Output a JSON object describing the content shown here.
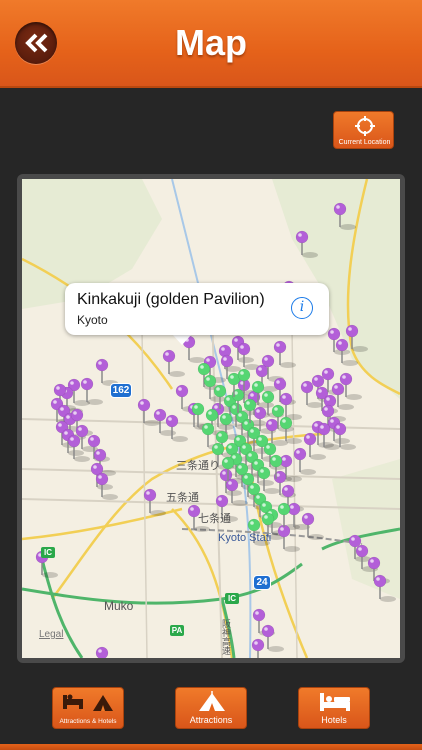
{
  "header": {
    "title": "Map",
    "back_icon": "back-chevrons-icon"
  },
  "current_location": {
    "label": "Current Location",
    "icon": "crosshair-icon"
  },
  "map": {
    "callout": {
      "title": "Kinkakuji (golden Pavilion)",
      "subtitle": "Kyoto",
      "info_icon": "info-icon"
    },
    "labels": {
      "sanjo": "三条通り",
      "gojo": "五条通",
      "shichijo": "七条通",
      "kyoto_station": "Kyoto Stati",
      "muko": "Muko",
      "legal": "Legal",
      "hanshin": "阪神高速"
    },
    "shields": {
      "r162": "162",
      "r24": "24",
      "ic_a": "IC",
      "ic_b": "IC",
      "pa": "PA"
    },
    "pin_colors": {
      "attraction": "#b35fd8",
      "hotel": "#55d672"
    }
  },
  "toolbar": {
    "buttons": [
      {
        "label": "Attractions & Hotels",
        "icon": "bed-and-tent-icon"
      },
      {
        "label": "Attractions",
        "icon": "tent-icon"
      },
      {
        "label": "Hotels",
        "icon": "bed-icon"
      }
    ]
  },
  "colors": {
    "accent": "#e5621a",
    "background": "#262626"
  }
}
